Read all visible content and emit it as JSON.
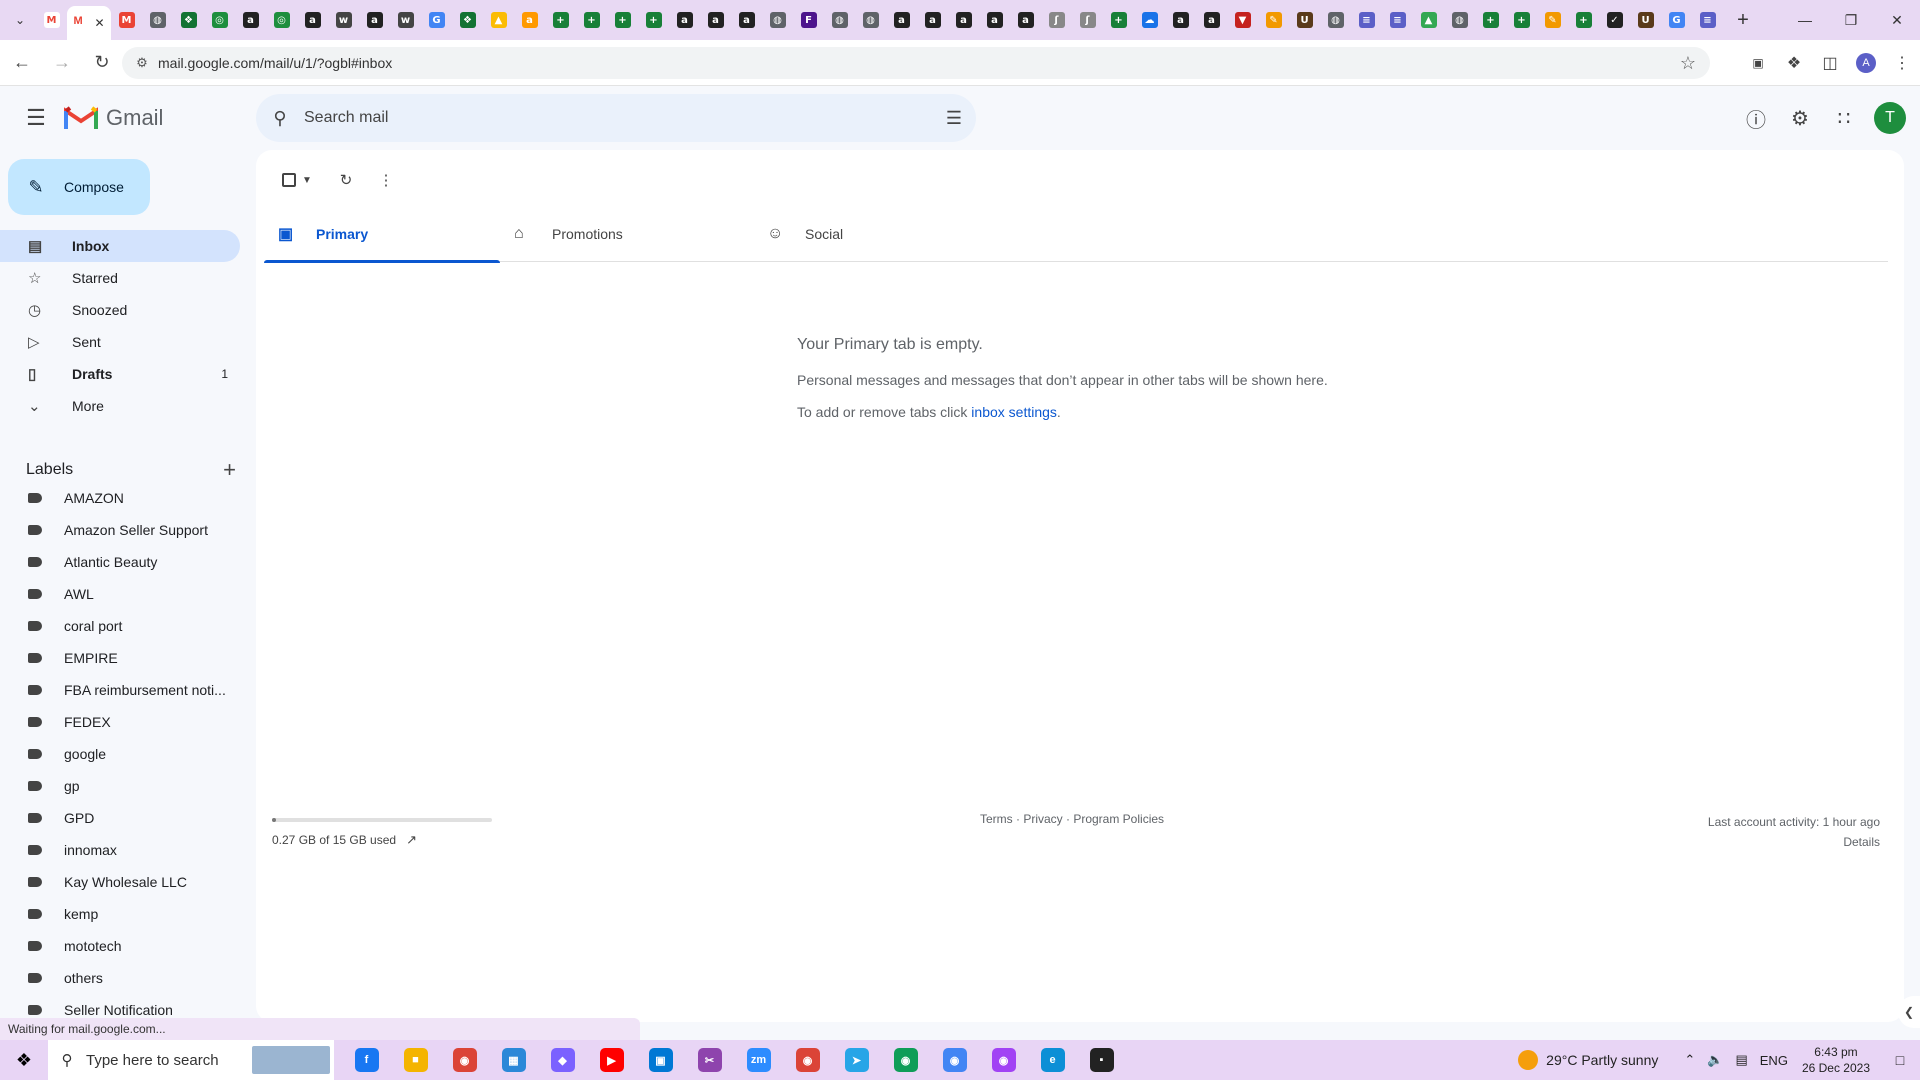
{
  "browser": {
    "url": "mail.google.com/mail/u/1/?ogbl#inbox",
    "profile_initial": "A",
    "tab_favicons": [
      {
        "name": "gmail-tab-icon",
        "char": "M",
        "color": "#ea4335"
      },
      {
        "name": "globe-tab-icon",
        "char": "◍",
        "color": "#5f6368"
      },
      {
        "name": "extension-tab-icon",
        "char": "❖",
        "color": "#137333"
      },
      {
        "name": "circle-tab-icon",
        "char": "◎",
        "color": "#1e8e3e"
      },
      {
        "name": "amazon-tab-icon",
        "char": "a",
        "color": "#222222"
      },
      {
        "name": "circle-tab-icon",
        "char": "◎",
        "color": "#1e8e3e"
      },
      {
        "name": "amazon-tab-icon",
        "char": "a",
        "color": "#222222"
      },
      {
        "name": "wix-tab-icon",
        "char": "w",
        "color": "#444444"
      },
      {
        "name": "amazon-tab-icon",
        "char": "a",
        "color": "#222222"
      },
      {
        "name": "wix-tab-icon",
        "char": "w",
        "color": "#444444"
      },
      {
        "name": "google-tab-icon",
        "char": "G",
        "color": "#4285f4"
      },
      {
        "name": "extension-tab-icon",
        "char": "❖",
        "color": "#137333"
      },
      {
        "name": "drive-tab-icon",
        "char": "▲",
        "color": "#fbbc04"
      },
      {
        "name": "amazon-tab-icon",
        "char": "a",
        "color": "#ff9900"
      },
      {
        "name": "sheets-tab-icon",
        "char": "+",
        "color": "#188038"
      },
      {
        "name": "sheets-tab-icon",
        "char": "+",
        "color": "#188038"
      },
      {
        "name": "sheets-tab-icon",
        "char": "+",
        "color": "#188038"
      },
      {
        "name": "sheets-tab-icon",
        "char": "+",
        "color": "#188038"
      },
      {
        "name": "amazon-tab-icon",
        "char": "a",
        "color": "#222222"
      },
      {
        "name": "amazon-tab-icon",
        "char": "a",
        "color": "#222222"
      },
      {
        "name": "amazon-tab-icon",
        "char": "a",
        "color": "#222222"
      },
      {
        "name": "globe-tab-icon",
        "char": "◍",
        "color": "#5f6368"
      },
      {
        "name": "fedex-tab-icon",
        "char": "F",
        "color": "#4d148c"
      },
      {
        "name": "globe-tab-icon",
        "char": "◍",
        "color": "#5f6368"
      },
      {
        "name": "globe-tab-icon",
        "char": "◍",
        "color": "#5f6368"
      },
      {
        "name": "amazon-tab-icon",
        "char": "a",
        "color": "#222222"
      },
      {
        "name": "amazon-tab-icon",
        "char": "a",
        "color": "#222222"
      },
      {
        "name": "amazon-tab-icon",
        "char": "a",
        "color": "#222222"
      },
      {
        "name": "amazon-tab-icon",
        "char": "a",
        "color": "#222222"
      },
      {
        "name": "amazon-tab-icon",
        "char": "a",
        "color": "#222222"
      },
      {
        "name": "script-tab-icon",
        "char": "ʃ",
        "color": "#888888"
      },
      {
        "name": "script-tab-icon",
        "char": "ʃ",
        "color": "#888888"
      },
      {
        "name": "sheets-tab-icon",
        "char": "+",
        "color": "#188038"
      },
      {
        "name": "cloud-tab-icon",
        "char": "☁",
        "color": "#1a73e8"
      },
      {
        "name": "amazon-tab-icon",
        "char": "a",
        "color": "#222222"
      },
      {
        "name": "amazon-tab-icon",
        "char": "a",
        "color": "#222222"
      },
      {
        "name": "triangle-tab-icon",
        "char": "▼",
        "color": "#c5221f"
      },
      {
        "name": "pencil-tab-icon",
        "char": "✎",
        "color": "#f29900"
      },
      {
        "name": "ups-tab-icon",
        "char": "U",
        "color": "#5a3a1a"
      },
      {
        "name": "globe-tab-icon",
        "char": "◍",
        "color": "#5f6368"
      },
      {
        "name": "list-tab-icon",
        "char": "≡",
        "color": "#5b5fc7"
      },
      {
        "name": "list-tab-icon",
        "char": "≡",
        "color": "#5b5fc7"
      },
      {
        "name": "drive-tab-icon",
        "char": "▲",
        "color": "#34a853"
      },
      {
        "name": "globe-tab-icon",
        "char": "◍",
        "color": "#5f6368"
      },
      {
        "name": "sheets-tab-icon",
        "char": "+",
        "color": "#188038"
      },
      {
        "name": "sheets-tab-icon",
        "char": "+",
        "color": "#188038"
      },
      {
        "name": "pencil-tab-icon",
        "char": "✎",
        "color": "#f29900"
      },
      {
        "name": "sheets-tab-icon",
        "char": "+",
        "color": "#188038"
      },
      {
        "name": "check-tab-icon",
        "char": "✓",
        "color": "#222222"
      },
      {
        "name": "ups-tab-icon",
        "char": "U",
        "color": "#5a3a1a"
      },
      {
        "name": "google-tab-icon",
        "char": "G",
        "color": "#4285f4"
      },
      {
        "name": "list-tab-icon",
        "char": "≡",
        "color": "#5b5fc7"
      }
    ]
  },
  "gmail": {
    "logo_text": "Gmail",
    "search_placeholder": "Search mail",
    "account_initial": "T",
    "compose_label": "Compose",
    "nav": [
      {
        "name": "inbox",
        "icon": "▤",
        "label": "Inbox",
        "count": "",
        "active": true,
        "bold": true
      },
      {
        "name": "starred",
        "icon": "☆",
        "label": "Starred",
        "count": "",
        "active": false,
        "bold": false
      },
      {
        "name": "snoozed",
        "icon": "◷",
        "label": "Snoozed",
        "count": "",
        "active": false,
        "bold": false
      },
      {
        "name": "sent",
        "icon": "▷",
        "label": "Sent",
        "count": "",
        "active": false,
        "bold": false
      },
      {
        "name": "drafts",
        "icon": "▯",
        "label": "Drafts",
        "count": "1",
        "active": false,
        "bold": true
      },
      {
        "name": "more",
        "icon": "⌄",
        "label": "More",
        "count": "",
        "active": false,
        "bold": false
      }
    ],
    "labels_heading": "Labels",
    "labels": [
      "AMAZON",
      "Amazon Seller Support",
      "Atlantic Beauty",
      "AWL",
      "coral port",
      "EMPIRE",
      "FBA reimbursement noti...",
      "FEDEX",
      "google",
      "gp",
      "GPD",
      "innomax",
      "Kay Wholesale LLC",
      "kemp",
      "mototech",
      "others",
      "Seller Notification"
    ],
    "tabs": [
      {
        "name": "primary",
        "icon": "▣",
        "label": "Primary",
        "active": true
      },
      {
        "name": "promotions",
        "icon": "⌂",
        "label": "Promotions",
        "active": false
      },
      {
        "name": "social",
        "icon": "☺",
        "label": "Social",
        "active": false
      }
    ],
    "empty": {
      "heading": "Your Primary tab is empty.",
      "body": "Personal messages and messages that don’t appear in other tabs will be shown here.",
      "settings_prefix": "To add or remove tabs click ",
      "settings_link": "inbox settings",
      "settings_suffix": "."
    },
    "storage": {
      "used_text": "0.27 GB of 15 GB used",
      "fraction": 0.018
    },
    "policies": "Terms · Privacy · Program Policies",
    "activity": {
      "last": "Last account activity: 1 hour ago",
      "details": "Details"
    }
  },
  "status_text": "Waiting for mail.google.com...",
  "taskbar": {
    "search_placeholder": "Type here to search",
    "apps": [
      {
        "name": "facebook-app-icon",
        "char": "f",
        "color": "#1877f2"
      },
      {
        "name": "file-explorer-app-icon",
        "char": "■",
        "color": "#f4b400"
      },
      {
        "name": "chrome-app-icon",
        "char": "◉",
        "color": "#db4437"
      },
      {
        "name": "calculator-app-icon",
        "char": "▦",
        "color": "#2b88d8"
      },
      {
        "name": "copilot-app-icon",
        "char": "◆",
        "color": "#7b61ff"
      },
      {
        "name": "youtube-app-icon",
        "char": "▶",
        "color": "#ff0000"
      },
      {
        "name": "store-app-icon",
        "char": "▣",
        "color": "#0078d4"
      },
      {
        "name": "snipping-tool-app-icon",
        "char": "✂",
        "color": "#8e44ad"
      },
      {
        "name": "zoom-app-icon",
        "char": "zm",
        "color": "#2d8cff"
      },
      {
        "name": "chrome-app-icon",
        "char": "◉",
        "color": "#db4437"
      },
      {
        "name": "telegram-app-icon",
        "char": "➤",
        "color": "#27a5e7"
      },
      {
        "name": "chrome-app-icon",
        "char": "◉",
        "color": "#0f9d58"
      },
      {
        "name": "chrome-app-icon",
        "char": "◉",
        "color": "#4285f4"
      },
      {
        "name": "chrome-app-icon",
        "char": "◉",
        "color": "#a142f4"
      },
      {
        "name": "edge-app-icon",
        "char": "e",
        "color": "#0c8fd6"
      },
      {
        "name": "sticky-notes-app-icon",
        "char": "▪",
        "color": "#222222"
      }
    ],
    "weather": "29°C  Partly sunny",
    "lang": "ENG",
    "time": "6:43 pm",
    "date": "26 Dec 2023"
  }
}
